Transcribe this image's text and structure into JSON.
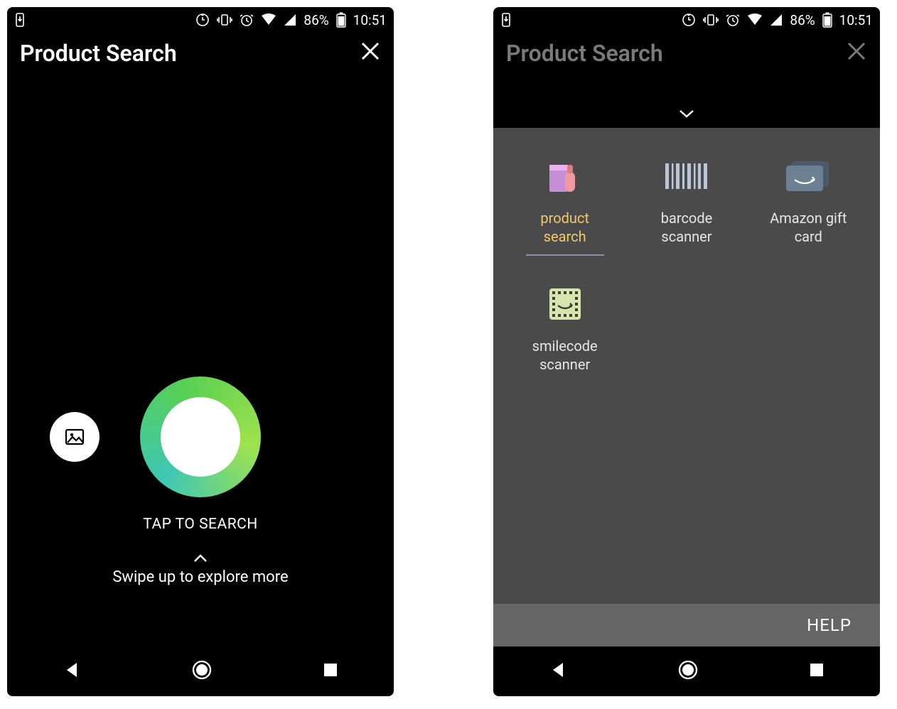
{
  "status": {
    "battery_pct": "86%",
    "time": "10:51"
  },
  "left": {
    "title": "Product Search",
    "tap_label": "TAP TO SEARCH",
    "swipe_label": "Swipe up to explore more"
  },
  "right": {
    "title": "Product Search",
    "items": [
      {
        "label": "product search"
      },
      {
        "label": "barcode scanner"
      },
      {
        "label": "Amazon gift card"
      },
      {
        "label": "smilecode scanner"
      }
    ],
    "help_label": "HELP"
  }
}
